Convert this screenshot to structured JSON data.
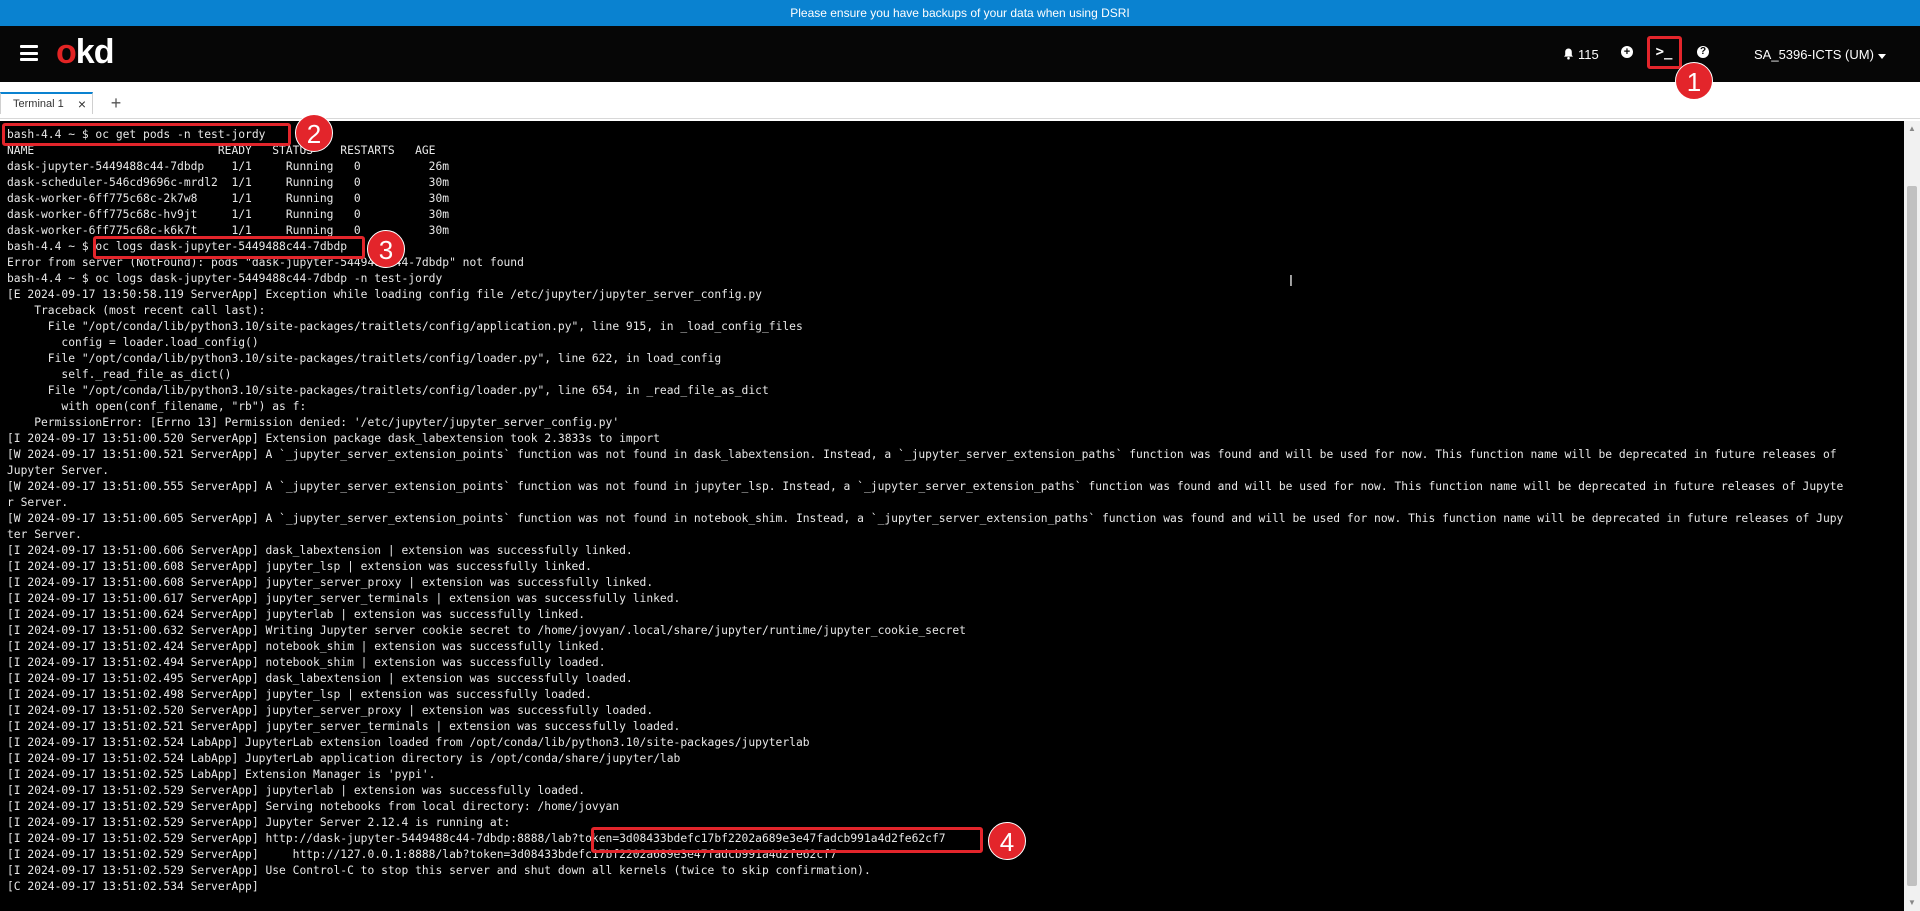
{
  "banner": {
    "text": "Please ensure you have backups of your data when using DSRI"
  },
  "masthead": {
    "logo": "okd",
    "notifications_count": "115",
    "user": "SA_5396-ICTS (UM)",
    "icons": [
      "menu-icon",
      "bell-icon",
      "plus-circle-icon",
      "terminal-icon",
      "help-icon",
      "caret-down-icon"
    ]
  },
  "tabs": {
    "items": [
      {
        "label": "Terminal 1",
        "close": "×"
      }
    ],
    "add": "+"
  },
  "terminal": {
    "lines": [
      "bash-4.4 ~ $ oc get pods -n test-jordy",
      "NAME                           READY   STATUS    RESTARTS   AGE",
      "dask-jupyter-5449488c44-7dbdp    1/1     Running   0          26m",
      "dask-scheduler-546cd9696c-mrdl2  1/1     Running   0          30m",
      "dask-worker-6ff775c68c-2k7w8     1/1     Running   0          30m",
      "dask-worker-6ff775c68c-hv9jt     1/1     Running   0          30m",
      "dask-worker-6ff775c68c-k6k7t     1/1     Running   0          30m",
      "bash-4.4 ~ $ oc logs dask-jupyter-5449488c44-7dbdp",
      "Error from server (NotFound): pods \"dask-jupyter-5449488c44-7dbdp\" not found",
      "bash-4.4 ~ $ oc logs dask-jupyter-5449488c44-7dbdp -n test-jordy",
      "[E 2024-09-17 13:50:58.119 ServerApp] Exception while loading config file /etc/jupyter/jupyter_server_config.py",
      "    Traceback (most recent call last):",
      "      File \"/opt/conda/lib/python3.10/site-packages/traitlets/config/application.py\", line 915, in _load_config_files",
      "        config = loader.load_config()",
      "      File \"/opt/conda/lib/python3.10/site-packages/traitlets/config/loader.py\", line 622, in load_config",
      "        self._read_file_as_dict()",
      "      File \"/opt/conda/lib/python3.10/site-packages/traitlets/config/loader.py\", line 654, in _read_file_as_dict",
      "        with open(conf_filename, \"rb\") as f:",
      "    PermissionError: [Errno 13] Permission denied: '/etc/jupyter/jupyter_server_config.py'",
      "[I 2024-09-17 13:51:00.520 ServerApp] Extension package dask_labextension took 2.3833s to import",
      "[W 2024-09-17 13:51:00.521 ServerApp] A `_jupyter_server_extension_points` function was not found in dask_labextension. Instead, a `_jupyter_server_extension_paths` function was found and will be used for now. This function name will be deprecated in future releases of",
      "Jupyter Server.",
      "[W 2024-09-17 13:51:00.555 ServerApp] A `_jupyter_server_extension_points` function was not found in jupyter_lsp. Instead, a `_jupyter_server_extension_paths` function was found and will be used for now. This function name will be deprecated in future releases of Jupyte",
      "r Server.",
      "[W 2024-09-17 13:51:00.605 ServerApp] A `_jupyter_server_extension_points` function was not found in notebook_shim. Instead, a `_jupyter_server_extension_paths` function was found and will be used for now. This function name will be deprecated in future releases of Jupy",
      "ter Server.",
      "[I 2024-09-17 13:51:00.606 ServerApp] dask_labextension | extension was successfully linked.",
      "[I 2024-09-17 13:51:00.608 ServerApp] jupyter_lsp | extension was successfully linked.",
      "[I 2024-09-17 13:51:00.608 ServerApp] jupyter_server_proxy | extension was successfully linked.",
      "[I 2024-09-17 13:51:00.617 ServerApp] jupyter_server_terminals | extension was successfully linked.",
      "[I 2024-09-17 13:51:00.624 ServerApp] jupyterlab | extension was successfully linked.",
      "[I 2024-09-17 13:51:00.632 ServerApp] Writing Jupyter server cookie secret to /home/jovyan/.local/share/jupyter/runtime/jupyter_cookie_secret",
      "[I 2024-09-17 13:51:02.424 ServerApp] notebook_shim | extension was successfully linked.",
      "[I 2024-09-17 13:51:02.494 ServerApp] notebook_shim | extension was successfully loaded.",
      "[I 2024-09-17 13:51:02.495 ServerApp] dask_labextension | extension was successfully loaded.",
      "[I 2024-09-17 13:51:02.498 ServerApp] jupyter_lsp | extension was successfully loaded.",
      "[I 2024-09-17 13:51:02.520 ServerApp] jupyter_server_proxy | extension was successfully loaded.",
      "[I 2024-09-17 13:51:02.521 ServerApp] jupyter_server_terminals | extension was successfully loaded.",
      "[I 2024-09-17 13:51:02.524 LabApp] JupyterLab extension loaded from /opt/conda/lib/python3.10/site-packages/jupyterlab",
      "[I 2024-09-17 13:51:02.524 LabApp] JupyterLab application directory is /opt/conda/share/jupyter/lab",
      "[I 2024-09-17 13:51:02.525 LabApp] Extension Manager is 'pypi'.",
      "[I 2024-09-17 13:51:02.529 ServerApp] jupyterlab | extension was successfully loaded.",
      "[I 2024-09-17 13:51:02.529 ServerApp] Serving notebooks from local directory: /home/jovyan",
      "[I 2024-09-17 13:51:02.529 ServerApp] Jupyter Server 2.12.4 is running at:",
      "[I 2024-09-17 13:51:02.529 ServerApp] http://dask-jupyter-5449488c44-7dbdp:8888/lab?token=3d08433bdefc17bf2202a689e3e47fadcb991a4d2fe62cf7",
      "[I 2024-09-17 13:51:02.529 ServerApp]     http://127.0.0.1:8888/lab?token=3d08433bdefc17bf2202a689e3e47fadcb991a4d2fe62cf7",
      "[I 2024-09-17 13:51:02.529 ServerApp] Use Control-C to stop this server and shut down all kernels (twice to skip confirmation).",
      "[C 2024-09-17 13:51:02.534 ServerApp]"
    ]
  },
  "annotations": {
    "markers": [
      "1",
      "2",
      "3",
      "4"
    ]
  }
}
